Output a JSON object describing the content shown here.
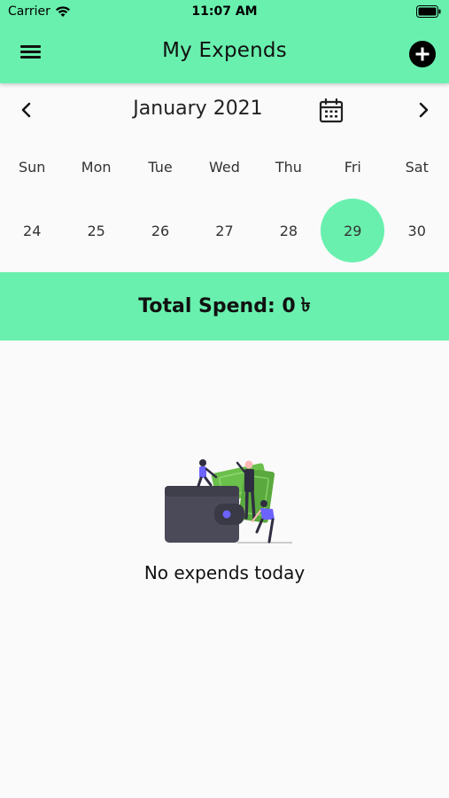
{
  "status": {
    "carrier": "Carrier",
    "time": "11:07 AM"
  },
  "appbar": {
    "title": "My Expends"
  },
  "calendar": {
    "month": "January 2021",
    "weekdays": [
      "Sun",
      "Mon",
      "Tue",
      "Wed",
      "Thu",
      "Fri",
      "Sat"
    ],
    "days": [
      "24",
      "25",
      "26",
      "27",
      "28",
      "29",
      "30"
    ],
    "selected_day": "29"
  },
  "summary": {
    "label": "Total Spend: 0",
    "currency_symbol": "৳"
  },
  "empty_state": {
    "message": "No expends today"
  },
  "colors": {
    "accent": "#69f0ae",
    "background": "#fafafa",
    "wallet": "#4b4a58",
    "money": "#6bbf4b"
  },
  "icons": {
    "menu": "menu-icon",
    "add": "add-circle-icon",
    "prev": "chevron-left-icon",
    "next": "chevron-right-icon",
    "calendar": "calendar-icon",
    "wifi": "wifi-icon",
    "battery": "battery-icon"
  }
}
